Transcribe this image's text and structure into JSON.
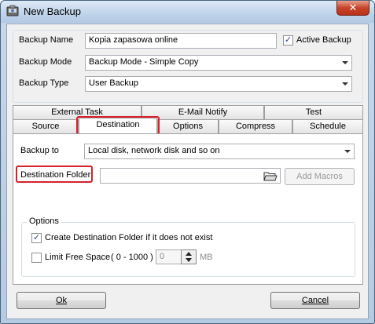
{
  "window": {
    "title": "New Backup",
    "close_glyph": "✕"
  },
  "general": {
    "backup_name_label": "Backup Name",
    "backup_name_value": "Kopia zapasowa online",
    "active_backup_label": "Active Backup",
    "active_backup_checked": true,
    "backup_mode_label": "Backup Mode",
    "backup_mode_value": "Backup Mode - Simple Copy",
    "backup_type_label": "Backup Type",
    "backup_type_value": "User Backup"
  },
  "tabs": {
    "row1": [
      {
        "label": "External Task"
      },
      {
        "label": "E-Mail Notify"
      },
      {
        "label": "Test"
      }
    ],
    "row2": [
      {
        "label": "Source"
      },
      {
        "label": "Destination",
        "active": true
      },
      {
        "label": "Options"
      },
      {
        "label": "Compress"
      },
      {
        "label": "Schedule"
      }
    ]
  },
  "destination": {
    "backup_to_label": "Backup to",
    "backup_to_value": "Local disk, network disk and so on",
    "destination_folder_label": "Destination Folder",
    "destination_folder_value": "",
    "add_macros_label": "Add Macros",
    "options_legend": "Options",
    "create_folder_label": "Create Destination Folder if it does not exist",
    "create_folder_checked": true,
    "limit_free_space_label": "Limit Free Space",
    "limit_range": "( 0 - 1000 )",
    "limit_value": "0",
    "limit_unit": "MB",
    "limit_checked": false
  },
  "footer": {
    "ok_label": "Ok",
    "cancel_label": "Cancel"
  },
  "colors": {
    "highlight": "#d7202a",
    "window_frame": "#b5cbe2"
  },
  "icons": {
    "app": "backup-app-icon",
    "browse": "folder-open-icon",
    "spin": "spin-arrows-icon"
  }
}
